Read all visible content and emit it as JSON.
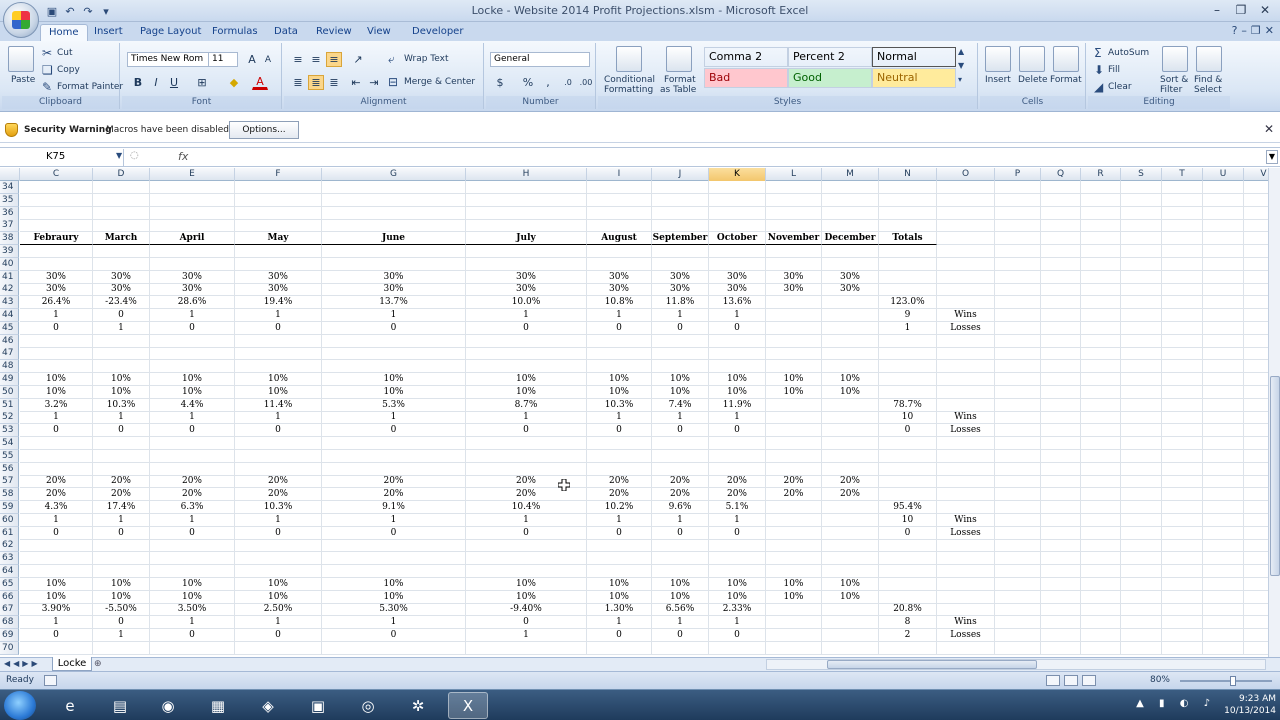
{
  "window": {
    "title": "Locke - Website 2014 Profit Projections.xlsm - Microsoft Excel"
  },
  "ribbon_tabs": [
    "Home",
    "Insert",
    "Page Layout",
    "Formulas",
    "Data",
    "Review",
    "View",
    "Developer"
  ],
  "active_tab": "Home",
  "ribbon": {
    "clipboard": {
      "paste": "Paste",
      "cut": "Cut",
      "copy": "Copy",
      "format_painter": "Format Painter",
      "label": "Clipboard"
    },
    "font": {
      "name": "Times New Rom",
      "size": "11",
      "label": "Font"
    },
    "alignment": {
      "wrap_text": "Wrap Text",
      "merge_center": "Merge & Center",
      "label": "Alignment"
    },
    "number": {
      "format": "General",
      "label": "Number"
    },
    "styles": {
      "conditional": "Conditional",
      "conditional2": "Formatting",
      "format_table": "Format",
      "format_table2": "as Table",
      "items": [
        {
          "name": "Comma 2",
          "bg": "#ffffff",
          "fg": "#000000"
        },
        {
          "name": "Percent 2",
          "bg": "#ffffff",
          "fg": "#000000"
        },
        {
          "name": "Normal",
          "bg": "#ffffff",
          "fg": "#000000"
        },
        {
          "name": "Bad",
          "bg": "#ffc7ce",
          "fg": "#9c0006"
        },
        {
          "name": "Good",
          "bg": "#c6efce",
          "fg": "#006100"
        },
        {
          "name": "Neutral",
          "bg": "#ffeb9c",
          "fg": "#9c6500"
        }
      ],
      "label": "Styles"
    },
    "cells": {
      "insert": "Insert",
      "delete": "Delete",
      "format": "Format",
      "label": "Cells"
    },
    "editing": {
      "autosum": "AutoSum",
      "fill": "Fill",
      "clear": "Clear",
      "sort": "Sort &",
      "sort2": "Filter",
      "find": "Find &",
      "find2": "Select",
      "label": "Editing"
    }
  },
  "security": {
    "title": "Security Warning",
    "message": "Macros have been disabled.",
    "options": "Options..."
  },
  "formula_bar": {
    "name_box": "K75",
    "fx": "fx",
    "value": ""
  },
  "columns": [
    "C",
    "D",
    "E",
    "F",
    "G",
    "H",
    "I",
    "J",
    "K",
    "L",
    "M",
    "N",
    "O",
    "P",
    "Q",
    "R",
    "S",
    "T",
    "U",
    "V"
  ],
  "selected_column": "K",
  "rows": [
    {
      "n": "34",
      "cells": []
    },
    {
      "n": "35",
      "cells": []
    },
    {
      "n": "36",
      "cells": []
    },
    {
      "n": "37",
      "cells": []
    },
    {
      "n": "38",
      "bold": true,
      "cells": [
        "Febraury",
        "March",
        "April",
        "May",
        "June",
        "July",
        "August",
        "September",
        "October",
        "November",
        "December",
        "Totals"
      ]
    },
    {
      "n": "39",
      "cells": []
    },
    {
      "n": "40",
      "cells": []
    },
    {
      "n": "41",
      "cells": [
        "30%",
        "30%",
        "30%",
        "30%",
        "30%",
        "30%",
        "30%",
        "30%",
        "30%",
        "30%",
        "30%",
        ""
      ]
    },
    {
      "n": "42",
      "cells": [
        "30%",
        "30%",
        "30%",
        "30%",
        "30%",
        "30%",
        "30%",
        "30%",
        "30%",
        "30%",
        "30%",
        ""
      ]
    },
    {
      "n": "43",
      "cells": [
        "26.4%",
        "-23.4%",
        "28.6%",
        "19.4%",
        "13.7%",
        "10.0%",
        "10.8%",
        "11.8%",
        "13.6%",
        "",
        "",
        "123.0%"
      ]
    },
    {
      "n": "44",
      "cells": [
        "1",
        "0",
        "1",
        "1",
        "1",
        "1",
        "1",
        "1",
        "1",
        "",
        "",
        "9",
        "Wins"
      ]
    },
    {
      "n": "45",
      "cells": [
        "0",
        "1",
        "0",
        "0",
        "0",
        "0",
        "0",
        "0",
        "0",
        "",
        "",
        "1",
        "Losses"
      ]
    },
    {
      "n": "46",
      "cells": []
    },
    {
      "n": "47",
      "cells": []
    },
    {
      "n": "48",
      "cells": []
    },
    {
      "n": "49",
      "cells": [
        "10%",
        "10%",
        "10%",
        "10%",
        "10%",
        "10%",
        "10%",
        "10%",
        "10%",
        "10%",
        "10%",
        ""
      ]
    },
    {
      "n": "50",
      "cells": [
        "10%",
        "10%",
        "10%",
        "10%",
        "10%",
        "10%",
        "10%",
        "10%",
        "10%",
        "10%",
        "10%",
        ""
      ]
    },
    {
      "n": "51",
      "cells": [
        "3.2%",
        "10.3%",
        "4.4%",
        "11.4%",
        "5.3%",
        "8.7%",
        "10.3%",
        "7.4%",
        "11.9%",
        "",
        "",
        "78.7%"
      ]
    },
    {
      "n": "52",
      "cells": [
        "1",
        "1",
        "1",
        "1",
        "1",
        "1",
        "1",
        "1",
        "1",
        "",
        "",
        "10",
        "Wins"
      ]
    },
    {
      "n": "53",
      "cells": [
        "0",
        "0",
        "0",
        "0",
        "0",
        "0",
        "0",
        "0",
        "0",
        "",
        "",
        "0",
        "Losses"
      ]
    },
    {
      "n": "54",
      "cells": []
    },
    {
      "n": "55",
      "cells": []
    },
    {
      "n": "56",
      "cells": []
    },
    {
      "n": "57",
      "cells": [
        "20%",
        "20%",
        "20%",
        "20%",
        "20%",
        "20%",
        "20%",
        "20%",
        "20%",
        "20%",
        "20%",
        ""
      ]
    },
    {
      "n": "58",
      "cells": [
        "20%",
        "20%",
        "20%",
        "20%",
        "20%",
        "20%",
        "20%",
        "20%",
        "20%",
        "20%",
        "20%",
        ""
      ]
    },
    {
      "n": "59",
      "cells": [
        "4.3%",
        "17.4%",
        "6.3%",
        "10.3%",
        "9.1%",
        "10.4%",
        "10.2%",
        "9.6%",
        "5.1%",
        "",
        "",
        "95.4%"
      ]
    },
    {
      "n": "60",
      "cells": [
        "1",
        "1",
        "1",
        "1",
        "1",
        "1",
        "1",
        "1",
        "1",
        "",
        "",
        "10",
        "Wins"
      ]
    },
    {
      "n": "61",
      "cells": [
        "0",
        "0",
        "0",
        "0",
        "0",
        "0",
        "0",
        "0",
        "0",
        "",
        "",
        "0",
        "Losses"
      ]
    },
    {
      "n": "62",
      "cells": []
    },
    {
      "n": "63",
      "cells": []
    },
    {
      "n": "64",
      "cells": []
    },
    {
      "n": "65",
      "cells": [
        "10%",
        "10%",
        "10%",
        "10%",
        "10%",
        "10%",
        "10%",
        "10%",
        "10%",
        "10%",
        "10%",
        ""
      ]
    },
    {
      "n": "66",
      "cells": [
        "10%",
        "10%",
        "10%",
        "10%",
        "10%",
        "10%",
        "10%",
        "10%",
        "10%",
        "10%",
        "10%",
        ""
      ]
    },
    {
      "n": "67",
      "cells": [
        "3.90%",
        "-5.50%",
        "3.50%",
        "2.50%",
        "5.30%",
        "-9.40%",
        "1.30%",
        "6.56%",
        "2.33%",
        "",
        "",
        "20.8%"
      ]
    },
    {
      "n": "68",
      "cells": [
        "1",
        "0",
        "1",
        "1",
        "1",
        "0",
        "1",
        "1",
        "1",
        "",
        "",
        "8",
        "Wins"
      ]
    },
    {
      "n": "69",
      "cells": [
        "0",
        "1",
        "0",
        "0",
        "0",
        "1",
        "0",
        "0",
        "0",
        "",
        "",
        "2",
        "Losses"
      ]
    },
    {
      "n": "70",
      "cells": []
    }
  ],
  "sheet_tabs": [
    "Locke"
  ],
  "status": {
    "ready": "Ready",
    "zoom": "80%"
  },
  "taskbar": {
    "time": "9:23 AM",
    "date": "10/13/2014",
    "apps": [
      "ie-icon",
      "folder-icon",
      "firefox-icon",
      "app-icon",
      "app-icon",
      "app-icon",
      "app-icon",
      "app-icon",
      "excel-icon"
    ]
  }
}
